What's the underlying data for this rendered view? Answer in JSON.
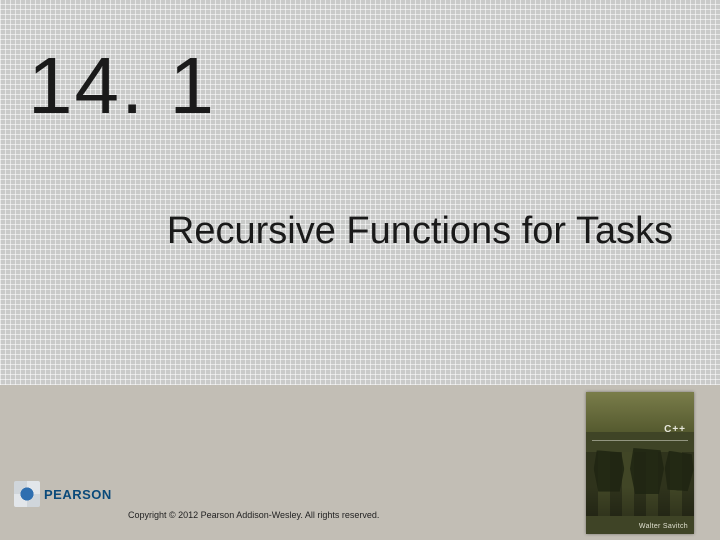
{
  "section": {
    "number": "14. 1",
    "title": "Recursive Functions for Tasks"
  },
  "publisher": {
    "name": "PEARSON"
  },
  "copyright": "Copyright © 2012 Pearson Addison-Wesley. All rights reserved.",
  "book": {
    "language": "C++",
    "author": "Walter Savitch"
  }
}
